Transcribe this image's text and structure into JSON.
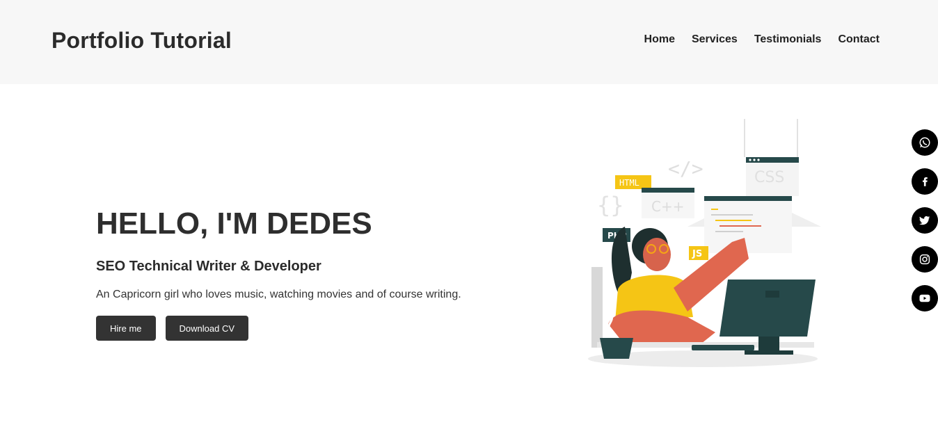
{
  "header": {
    "brand": "Portfolio Tutorial",
    "nav": [
      "Home",
      "Services",
      "Testimonials",
      "Contact"
    ]
  },
  "hero": {
    "title": "HELLO, I'M DEDES",
    "subtitle": "SEO Technical Writer & Developer",
    "description": "An Capricorn girl who loves music, watching movies and of course writing.",
    "buttons": {
      "hire": "Hire me",
      "download": "Download CV"
    }
  },
  "illustration": {
    "tags": {
      "html": "HTML",
      "php": "PHP",
      "js": "JS",
      "css": "CSS",
      "cpp": "C++",
      "braces": "{}",
      "code": "</>"
    }
  },
  "social": [
    "whatsapp-icon",
    "facebook-icon",
    "twitter-icon",
    "instagram-icon",
    "youtube-icon"
  ],
  "colors": {
    "header_bg": "#f7f7f7",
    "button_bg": "#333333",
    "accent_yellow": "#f5c515",
    "accent_coral": "#e0674f",
    "monitor": "#26494a"
  }
}
